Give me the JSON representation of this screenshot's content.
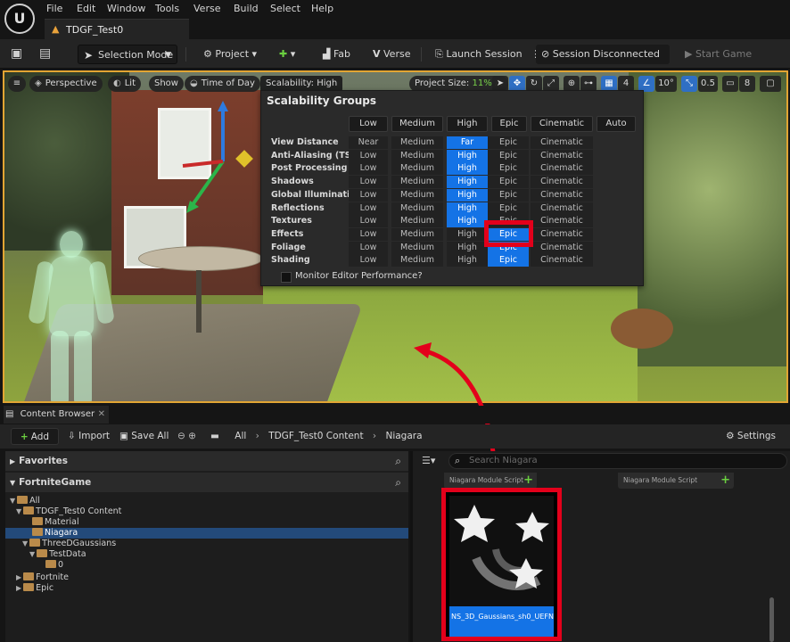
{
  "menu": {
    "items": [
      "File",
      "Edit",
      "Window",
      "Tools",
      "Verse",
      "Build",
      "Select",
      "Help"
    ]
  },
  "project_tab": {
    "title": "TDGF_Test0"
  },
  "toolbar": {
    "selection_mode": "Selection Mode",
    "project": "Project",
    "fab": "Fab",
    "verse": "Verse",
    "launch_session": "Launch Session",
    "session_status": "Session Disconnected",
    "start_game": "Start Game"
  },
  "viewport": {
    "perspective": "Perspective",
    "lit": "Lit",
    "show": "Show",
    "time_of_day": "Time of Day",
    "scalability": "Scalability: High",
    "project_size_label": "Project Size:",
    "project_size_value": "11%",
    "grid_value": "4",
    "rotation_value": "10°",
    "scale_value": "0.5",
    "camera_value": "8"
  },
  "scalability": {
    "title": "Scalability Groups",
    "presets": [
      "Low",
      "Medium",
      "High",
      "Epic",
      "Cinematic",
      "Auto"
    ],
    "rows": [
      {
        "name": "View Distance",
        "levels": [
          "Near",
          "Medium",
          "Far",
          "Epic",
          "Cinematic"
        ],
        "selected": 2
      },
      {
        "name": "Anti-Aliasing (TSR)",
        "levels": [
          "Low",
          "Medium",
          "High",
          "Epic",
          "Cinematic"
        ],
        "selected": 2
      },
      {
        "name": "Post Processing",
        "levels": [
          "Low",
          "Medium",
          "High",
          "Epic",
          "Cinematic"
        ],
        "selected": 2
      },
      {
        "name": "Shadows",
        "levels": [
          "Low",
          "Medium",
          "High",
          "Epic",
          "Cinematic"
        ],
        "selected": 2
      },
      {
        "name": "Global Illumination",
        "levels": [
          "Low",
          "Medium",
          "High",
          "Epic",
          "Cinematic"
        ],
        "selected": 2
      },
      {
        "name": "Reflections",
        "levels": [
          "Low",
          "Medium",
          "High",
          "Epic",
          "Cinematic"
        ],
        "selected": 2
      },
      {
        "name": "Textures",
        "levels": [
          "Low",
          "Medium",
          "High",
          "Epic",
          "Cinematic"
        ],
        "selected": 2
      },
      {
        "name": "Effects",
        "levels": [
          "Low",
          "Medium",
          "High",
          "Epic",
          "Cinematic"
        ],
        "selected": 3
      },
      {
        "name": "Foliage",
        "levels": [
          "Low",
          "Medium",
          "High",
          "Epic",
          "Cinematic"
        ],
        "selected": 3
      },
      {
        "name": "Shading",
        "levels": [
          "Low",
          "Medium",
          "High",
          "Epic",
          "Cinematic"
        ],
        "selected": 3
      }
    ],
    "monitor_label": "Monitor Editor Performance?"
  },
  "content_browser": {
    "tab_title": "Content Browser",
    "add": "Add",
    "import": "Import",
    "save_all": "Save All",
    "breadcrumb": [
      "All",
      "TDGF_Test0 Content",
      "Niagara"
    ],
    "settings": "Settings",
    "favorites": "Favorites",
    "project_root": "FortniteGame",
    "tree": [
      "All",
      "TDGF_Test0 Content",
      "Material",
      "Niagara",
      "ThreeDGaussians",
      "TestData",
      "0",
      "Fortnite",
      "Epic"
    ],
    "search_placeholder": "Search Niagara",
    "asset_strips": [
      "Niagara Module Script",
      "Niagara Module Script"
    ],
    "asset_name": "NS_3D_Gaussians_sh0_UEFN"
  },
  "colors": {
    "accent_blue": "#1473e6",
    "highlight_red": "#e3001b",
    "viewport_border": "#e2a533",
    "green": "#6bd040"
  }
}
